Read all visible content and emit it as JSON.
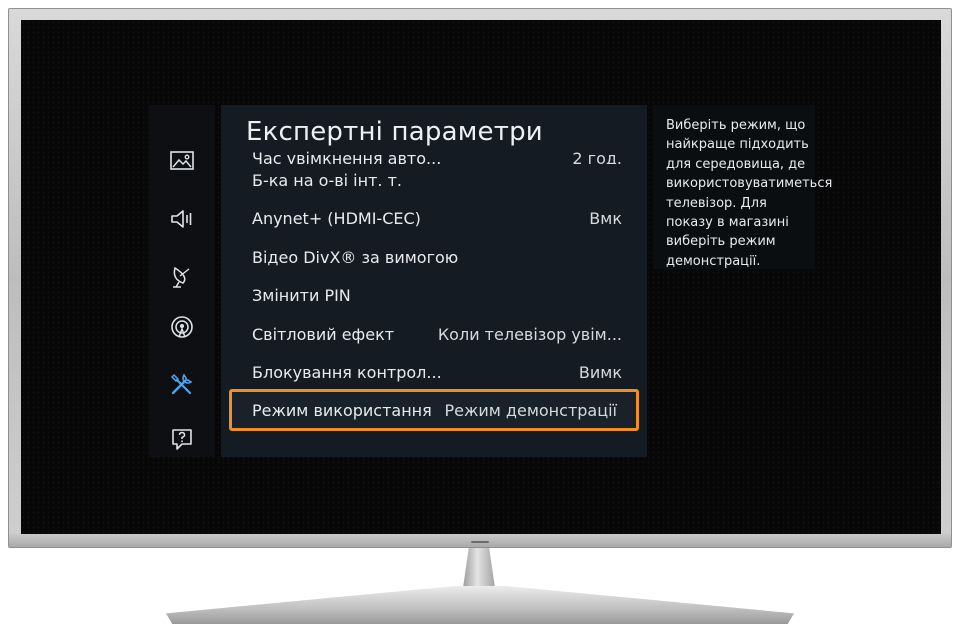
{
  "menu": {
    "title": "Експертні параметри",
    "items": [
      {
        "label": "Час увімкнення авто...",
        "value": "2 год."
      },
      {
        "label": "Б-ка на о-ві інт. т.",
        "value": ""
      },
      {
        "label": "Anynet+ (HDMI-CEC)",
        "value": "Вмк"
      },
      {
        "label": "Відео DivX® за вимогою",
        "value": ""
      },
      {
        "label": "Змінити PIN",
        "value": ""
      },
      {
        "label": "Світловий ефект",
        "value": "Коли телевізор увім..."
      },
      {
        "label": "Блокування контрол...",
        "value": "Вимк"
      },
      {
        "label": "Режим використання",
        "value": "Режим демонстрації",
        "selected": true
      }
    ]
  },
  "sidebar": {
    "icons": [
      "picture-icon",
      "sound-icon",
      "broadcast-icon",
      "network-icon",
      "tools-icon",
      "support-icon"
    ],
    "active": "tools-icon"
  },
  "description": {
    "text": "Виберіть режим, що найкраще підходить для середовища, де використовуватиметься телевізор. Для показу в магазині виберіть режим демонстрації."
  },
  "colors": {
    "highlight": "#f0901e",
    "active_icon": "#4fa3e8"
  }
}
